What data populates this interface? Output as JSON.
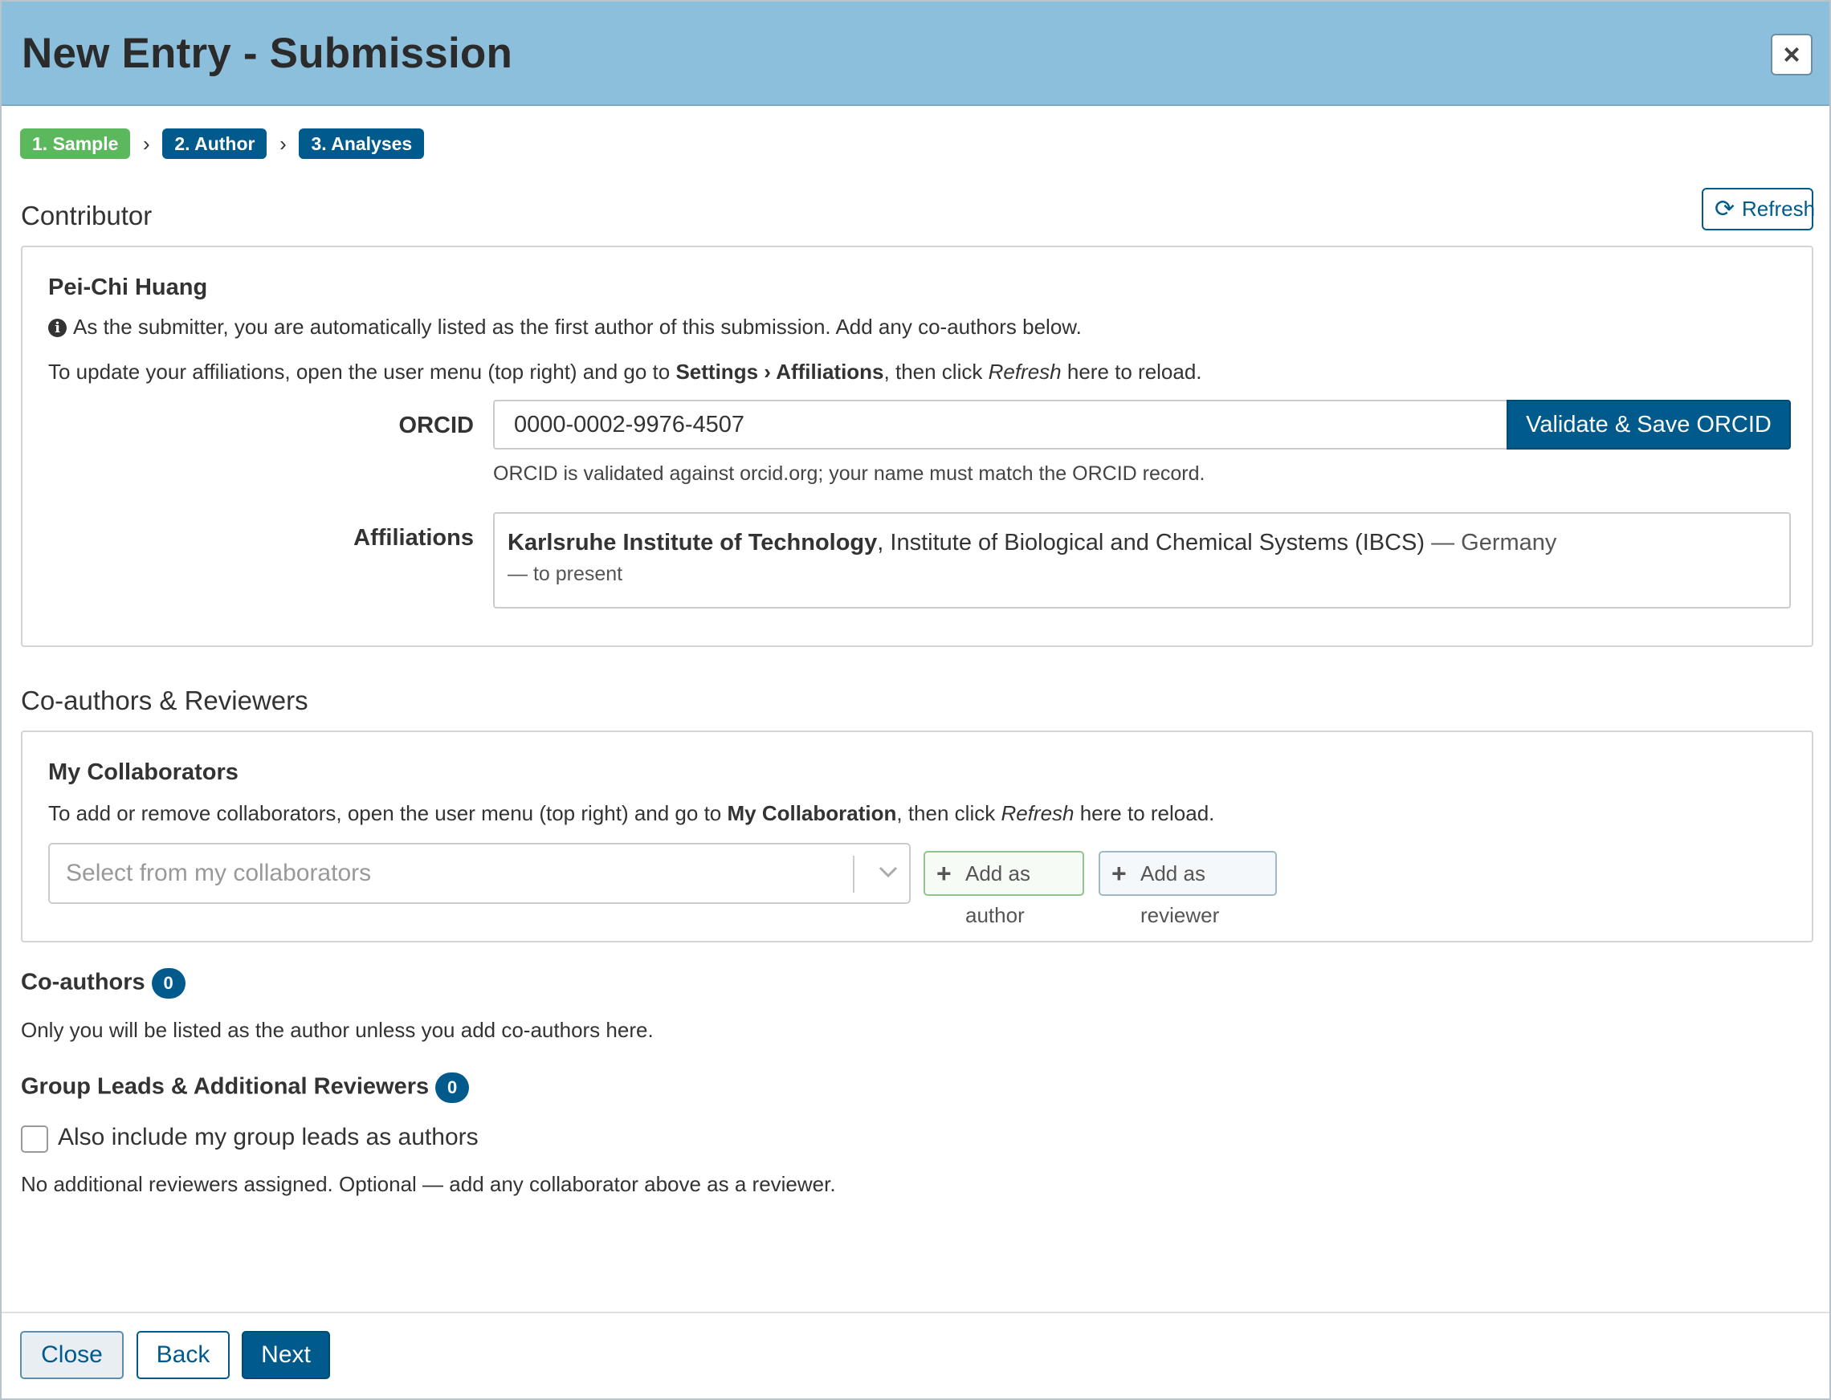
{
  "modal": {
    "title": "New Entry - Submission",
    "close_glyph": "×"
  },
  "steps": [
    {
      "label": "1. Sample",
      "state": "active"
    },
    {
      "label": "2. Author",
      "state": "todo"
    },
    {
      "label": "3. Analyses",
      "state": "todo"
    }
  ],
  "step_separator": "›",
  "contributor": {
    "heading": "Contributor",
    "refresh_label": "Refresh",
    "refresh_icon": "refresh-icon",
    "name": "Pei-Chi Huang",
    "info_text": "As the submitter, you are automatically listed as the first author of this submission. Add any co-authors below.",
    "update_prefix": "To update your affiliations, open the user menu (top right) and go to ",
    "update_settings": "Settings",
    "update_sep": " › ",
    "update_affiliations": "Affiliations",
    "update_mid": ", then click ",
    "update_refresh": "Refresh",
    "update_suffix": " here to reload.",
    "orcid_label": "ORCID",
    "orcid_value": "0000-0002-9976-4507",
    "orcid_button": "Validate & Save ORCID",
    "orcid_help": "ORCID is validated against orcid.org; your name must match the ORCID record.",
    "affiliations_label": "Affiliations",
    "affiliation": {
      "institution": "Karlsruhe Institute of Technology",
      "department": ", Institute of Biological and Chemical Systems (IBCS)",
      "country": " — Germany",
      "period": "— to present"
    }
  },
  "coauthors_section": {
    "heading": "Co-authors & Reviewers",
    "collab_title": "My Collaborators",
    "collab_prefix": "To add or remove collaborators, open the user menu (top right) and go to ",
    "collab_bold": "My Collaboration",
    "collab_mid": ", then click ",
    "collab_refresh": "Refresh",
    "collab_suffix": " here to reload.",
    "select_placeholder": "Select from my collaborators",
    "add_author_label": "Add as author",
    "add_reviewer_label": "Add as reviewer",
    "plus_glyph": "+"
  },
  "coauthors": {
    "title": "Co-authors",
    "count": "0",
    "note": "Only you will be listed as the author unless you add co-authors here."
  },
  "reviewers": {
    "title": "Group Leads & Additional Reviewers",
    "count": "0",
    "checkbox_label": "Also include my group leads as authors",
    "note": "No additional reviewers assigned. Optional — add any collaborator above as a reviewer."
  },
  "footer": {
    "close_label": "Close",
    "back_label": "Back",
    "next_label": "Next"
  },
  "colors": {
    "header_bg": "#8cbfdb",
    "primary": "#005b8c",
    "success": "#5cb85c"
  }
}
